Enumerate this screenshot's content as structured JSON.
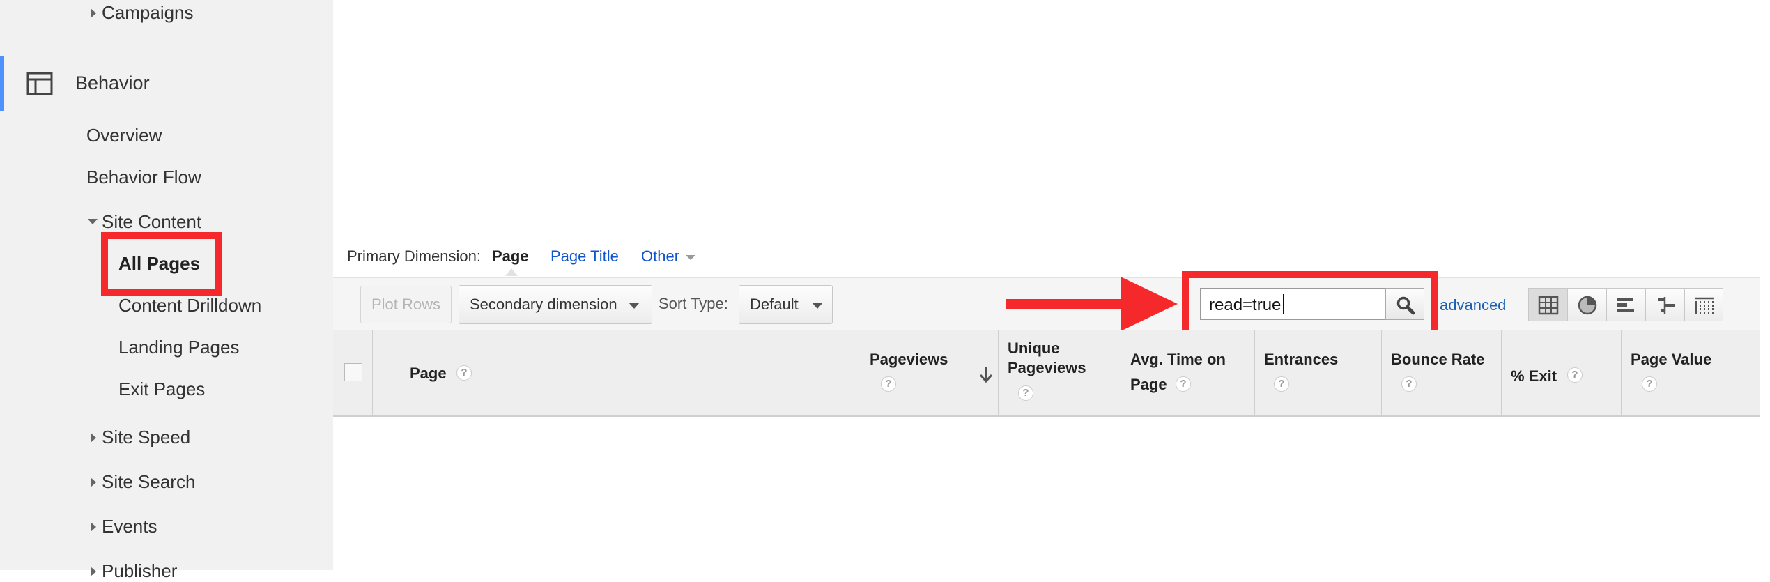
{
  "sidebar": {
    "campaigns": "Campaigns",
    "behavior": "Behavior",
    "overview": "Overview",
    "behavior_flow": "Behavior Flow",
    "site_content": "Site Content",
    "all_pages": "All Pages",
    "content_drilldown": "Content Drilldown",
    "landing_pages": "Landing Pages",
    "exit_pages": "Exit Pages",
    "site_speed": "Site Speed",
    "site_search": "Site Search",
    "events": "Events",
    "publisher": "Publisher"
  },
  "dimension_bar": {
    "label": "Primary Dimension:",
    "active": "Page",
    "page_title": "Page Title",
    "other": "Other"
  },
  "toolbar": {
    "plot_rows": "Plot Rows",
    "secondary_dimension": "Secondary dimension",
    "sort_type_label": "Sort Type:",
    "sort_type_value": "Default",
    "search_value": "read=true",
    "advanced": "advanced"
  },
  "table": {
    "columns": [
      "Page",
      "Pageviews",
      "Unique Pageviews",
      "Avg. Time on Page",
      "Entrances",
      "Bounce Rate",
      "% Exit",
      "Page Value"
    ],
    "help_glyph": "?"
  },
  "colors": {
    "highlight": "#f5292c",
    "link": "#1155cc",
    "accent": "#4d90fe"
  },
  "icons": [
    "behavior-layout-icon",
    "search-icon",
    "sort-down-arrow-icon",
    "table-view-icon",
    "pie-view-icon",
    "bar-view-icon",
    "comparison-view-icon",
    "pivot-view-icon"
  ]
}
